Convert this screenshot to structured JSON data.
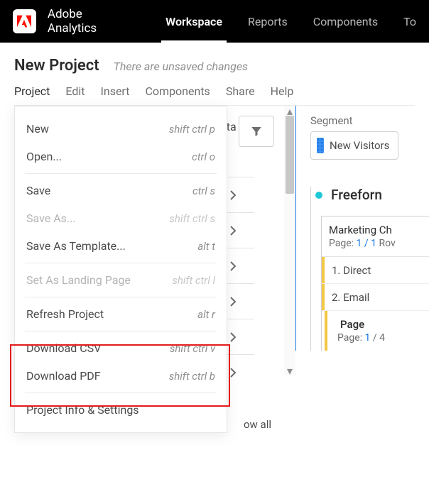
{
  "header": {
    "app_name": "Adobe Analytics",
    "tabs": [
      "Workspace",
      "Reports",
      "Components",
      "To"
    ],
    "active_tab": 0
  },
  "project": {
    "title": "New Project",
    "unsaved_message": "There are unsaved changes"
  },
  "menubar": [
    "Project",
    "Edit",
    "Insert",
    "Components",
    "Share",
    "Help"
  ],
  "project_menu": {
    "items": [
      {
        "label": "New",
        "shortcut": "shift ctrl p",
        "disabled": false
      },
      {
        "label": "Open...",
        "shortcut": "ctrl o",
        "disabled": false
      },
      {
        "sep": true
      },
      {
        "label": "Save",
        "shortcut": "ctrl s",
        "disabled": false
      },
      {
        "label": "Save As...",
        "shortcut": "shift ctrl s",
        "disabled": true
      },
      {
        "label": "Save As Template...",
        "shortcut": "alt t",
        "disabled": false
      },
      {
        "sep": true
      },
      {
        "label": "Set As Landing Page",
        "shortcut": "shift ctrl l",
        "disabled": true
      },
      {
        "sep": true
      },
      {
        "label": "Refresh Project",
        "shortcut": "alt r",
        "disabled": false
      },
      {
        "sep": true
      },
      {
        "label": "Download CSV",
        "shortcut": "shift ctrl v",
        "disabled": false
      },
      {
        "label": "Download PDF",
        "shortcut": "shift ctrl b",
        "disabled": false
      },
      {
        "sep": true
      },
      {
        "label": "Project Info & Settings",
        "shortcut": "",
        "disabled": false
      }
    ]
  },
  "sidebar_partial": {
    "fragment": "ata",
    "show_all": "ow all"
  },
  "right": {
    "segment_label": "Segment",
    "segment_chip": "New Visitors",
    "freeform_title": "Freeforn",
    "table": {
      "dim_header": "Marketing Ch",
      "dim_sub_prefix": "Page: ",
      "dim_sub_page": "1 / 1",
      "dim_sub_suffix": " Rov",
      "rows": [
        "1.  Direct",
        "2.  Email"
      ],
      "sub_header": "Page",
      "sub_sub_prefix": "Page: ",
      "sub_sub_page": "1",
      "sub_sub_suffix": " / 4"
    }
  }
}
